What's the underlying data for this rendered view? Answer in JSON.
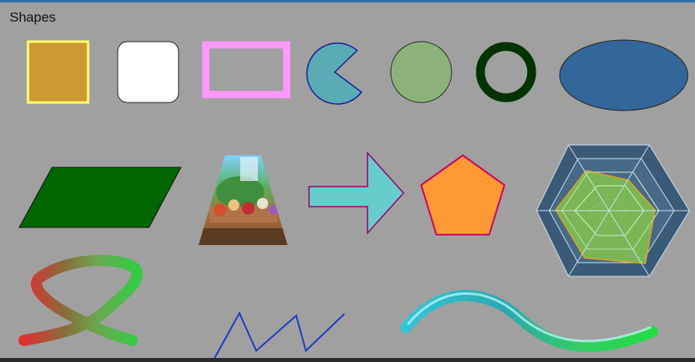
{
  "window": {
    "title": "Shapes"
  },
  "colors": {
    "background": "#a0a0a0",
    "square_fill": "#cc9933",
    "square_border": "#ffff66",
    "rounded_square_fill": "#ffffff",
    "pink_rect_border": "#ff99ff",
    "pie_fill": "#5aabb5",
    "pie_border": "#1a1a99",
    "circle_fill": "#8cb27a",
    "ring_color": "#003300",
    "ellipse_fill": "#336699",
    "parallelogram_fill": "#006600",
    "arrow_fill": "#66cccc",
    "arrow_border": "#990066",
    "pentagon_fill": "#ff9933",
    "pentagon_border": "#cc0066",
    "radar_hex_fill": "#3a5a78",
    "radar_value_fill": "#7fbf50",
    "radar_value_border": "#e6a020",
    "zigzag_color": "#1a3acc",
    "wave_color": "#33cc55"
  },
  "shapes": [
    {
      "name": "square",
      "icon": "filled-square"
    },
    {
      "name": "rounded-square",
      "icon": "rounded-rectangle"
    },
    {
      "name": "pink-rectangle-outline",
      "icon": "rectangle-outline"
    },
    {
      "name": "pie-pacman",
      "icon": "pie-slice"
    },
    {
      "name": "circle",
      "icon": "filled-circle"
    },
    {
      "name": "ring",
      "icon": "donut-ring"
    },
    {
      "name": "ellipse",
      "icon": "ellipse"
    },
    {
      "name": "parallelogram",
      "icon": "parallelogram"
    },
    {
      "name": "image-trapezoid",
      "icon": "image-in-trapezoid"
    },
    {
      "name": "arrow-right",
      "icon": "arrow"
    },
    {
      "name": "pentagon",
      "icon": "pentagon"
    },
    {
      "name": "radar-hexagon",
      "icon": "radar-chart"
    },
    {
      "name": "gradient-loop-stroke",
      "icon": "freehand-curve"
    },
    {
      "name": "zigzag-line",
      "icon": "polyline"
    },
    {
      "name": "glossy-wave",
      "icon": "bezier-curve"
    }
  ]
}
